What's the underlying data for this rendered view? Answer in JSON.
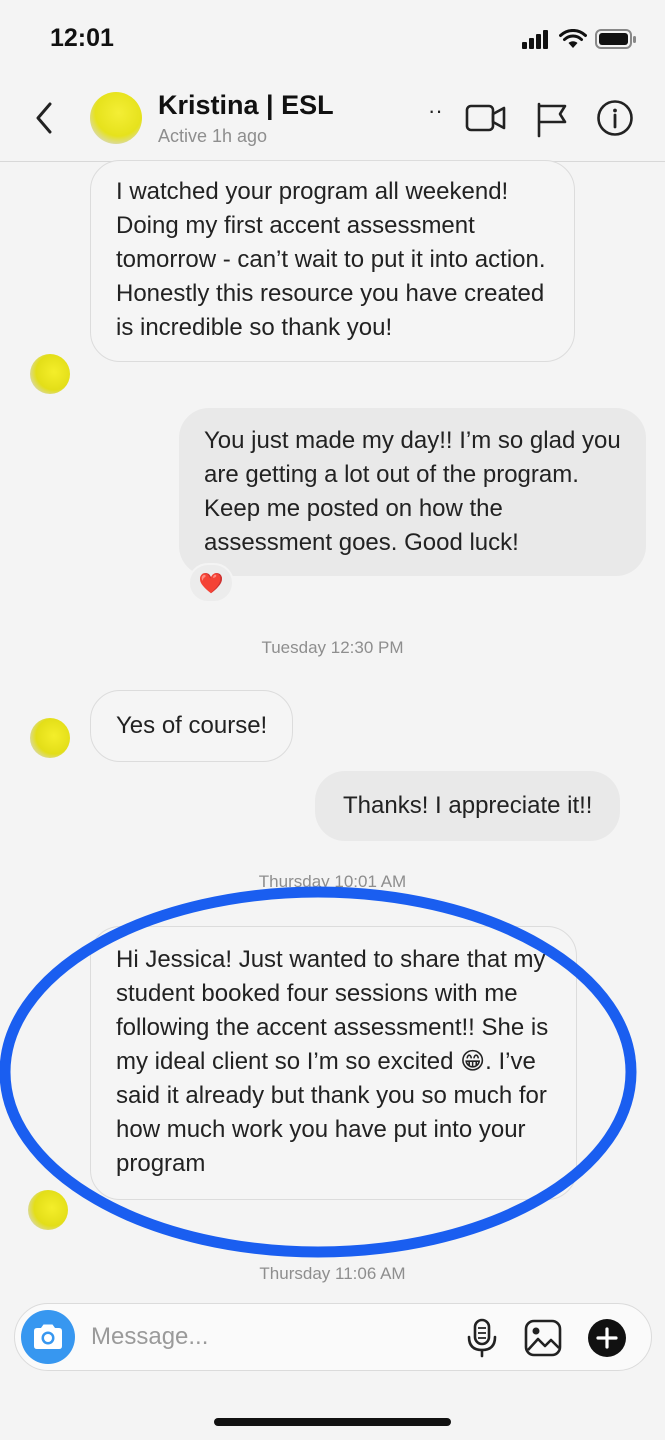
{
  "status_bar": {
    "time": "12:01"
  },
  "header": {
    "contact_name": "Kristina | ESL",
    "active_status": "Active 1h ago",
    "dots": "··"
  },
  "messages": [
    {
      "from": "them",
      "text": "I watched your program all weekend! Doing my first accent assessment tomorrow - can’t wait to put it into action. Honestly this resource you have created is incredible so thank you!"
    },
    {
      "from": "me",
      "text": "You just made my day!!  I’m so glad you are getting a lot out of the program. Keep me posted on how the assessment goes.  Good luck!",
      "reaction": "❤️"
    },
    {
      "from": "them",
      "text": "Yes of course!"
    },
    {
      "from": "me",
      "text": "Thanks!  I appreciate it!!"
    },
    {
      "from": "them",
      "text": "Hi Jessica! Just wanted to share that my student booked four sessions with me following the accent assessment!! She is my ideal client so I’m so excited 😁. I’ve said it already but thank you so much for how much work you have put into your program"
    }
  ],
  "timestamps": [
    "Tuesday 12:30 PM",
    "Thursday 10:01 AM",
    "Thursday 11:06 AM"
  ],
  "composer": {
    "placeholder": "Message..."
  },
  "colors": {
    "accent": "#3797f0",
    "highlight_circle": "#1a5ef0",
    "avatar": "#e8e31e"
  },
  "icons": [
    "back-chevron-icon",
    "video-call-icon",
    "flag-icon",
    "info-icon",
    "camera-icon",
    "microphone-icon",
    "gallery-icon",
    "plus-icon",
    "heart-reaction"
  ]
}
